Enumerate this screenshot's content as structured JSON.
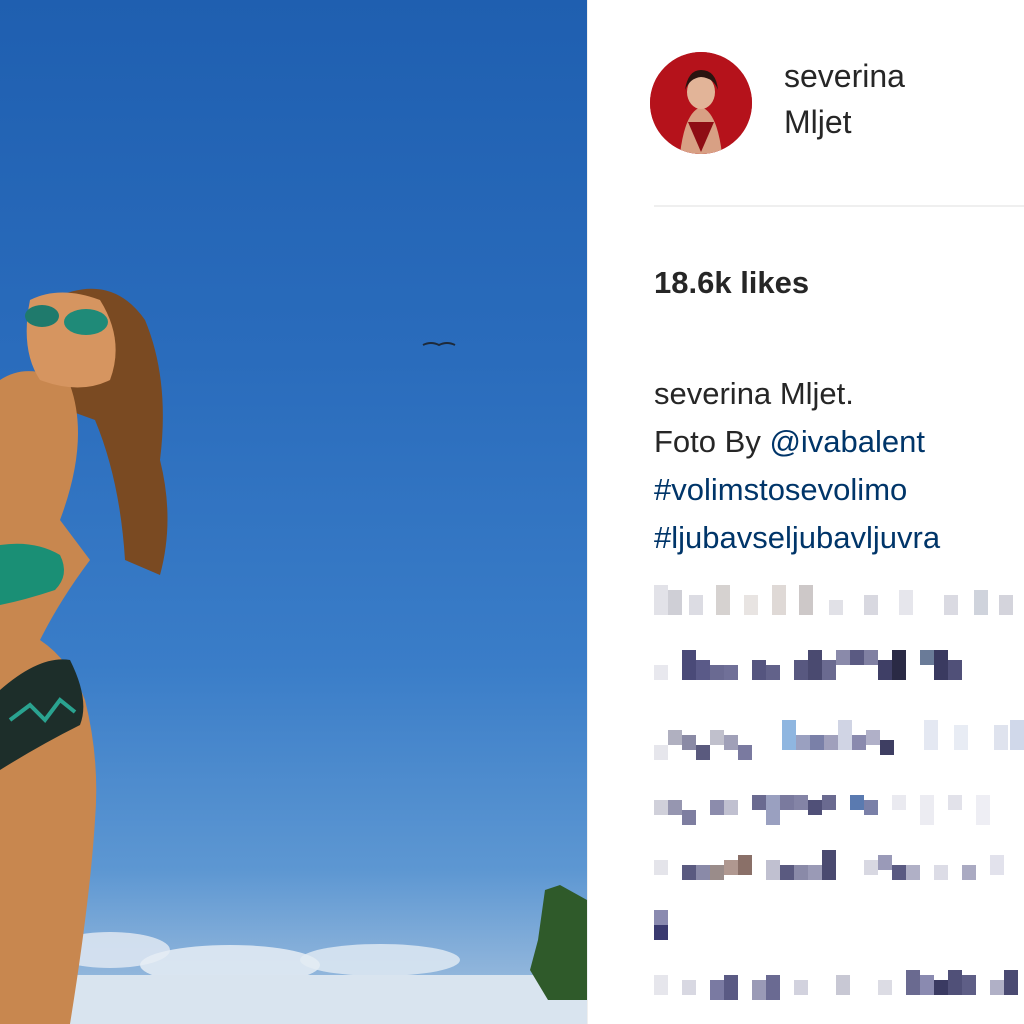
{
  "post": {
    "username": "severina",
    "location": "Mljet",
    "likes": "18.6k likes",
    "caption": {
      "author": "severina",
      "text": "Mljet.",
      "line2_prefix": "Foto By ",
      "mention": "@ivabalent",
      "hashtag1": "#volimstosevolimo",
      "hashtag2": "#ljubavseljubavljuvra"
    }
  },
  "colors": {
    "text": "#262626",
    "link": "#003569",
    "divider": "#efefef",
    "sky": "#2a6cbc"
  },
  "icons": {
    "avatar": "profile-photo"
  }
}
